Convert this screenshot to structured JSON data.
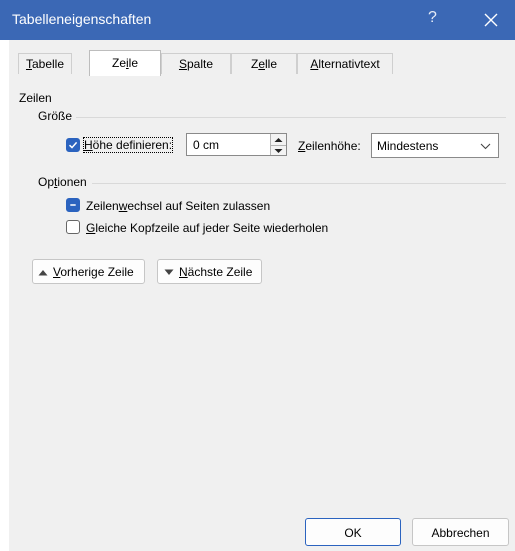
{
  "window": {
    "title": "Tabelleneigenschaften",
    "help_glyph": "?"
  },
  "tabs": [
    {
      "pre": "",
      "key": "T",
      "post": "abelle",
      "active": false
    },
    {
      "pre": "Ze",
      "key": "i",
      "post": "le",
      "active": true
    },
    {
      "pre": "",
      "key": "S",
      "post": "palte",
      "active": false
    },
    {
      "pre": "Z",
      "key": "e",
      "post": "lle",
      "active": false
    },
    {
      "pre": "",
      "key": "A",
      "post": "lternativtext",
      "active": false
    }
  ],
  "section_label": "Zeilen",
  "size_group": {
    "label": "Größe",
    "height_checkbox": {
      "pre": "",
      "key": "H",
      "post": "öhe definieren:",
      "checked": true
    },
    "height_value": "0 cm",
    "row_height_label": {
      "pre": "",
      "key": "Z",
      "post": "eilenhöhe:"
    },
    "row_height_mode": "Mindestens"
  },
  "options_group": {
    "label": {
      "pre": "Op",
      "key": "t",
      "post": "ionen"
    },
    "allow_break": {
      "pre": "Zeilen",
      "key": "w",
      "post": "echsel auf Seiten zulassen",
      "state": "indeterminate"
    },
    "repeat_header": {
      "pre": "",
      "key": "G",
      "post": "leiche Kopfzeile auf jeder Seite wiederholen",
      "checked": false
    }
  },
  "nav": {
    "prev": {
      "pre": "",
      "key": "V",
      "post": "orherige Zeile"
    },
    "next": {
      "pre": "",
      "key": "N",
      "post": "ächste Zeile"
    }
  },
  "footer": {
    "ok": "OK",
    "cancel": "Abbrechen"
  },
  "colors": {
    "titlebar": "#3b68b5",
    "accent": "#2b63bf"
  }
}
